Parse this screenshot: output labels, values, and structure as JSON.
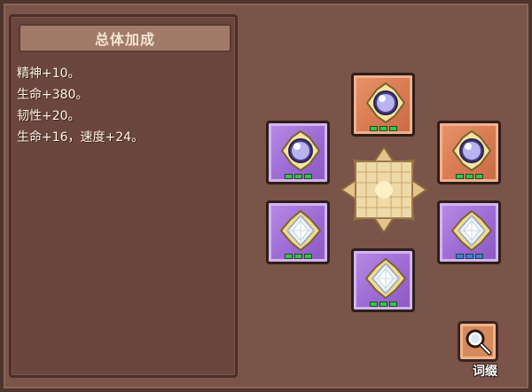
{
  "panel": {
    "title": "总体加成",
    "stats": [
      "精神+10。",
      "生命+380。",
      "韧性+20。",
      "生命+16，速度+24。"
    ]
  },
  "slots": [
    {
      "name": "gem-slot-top",
      "frame": "orange",
      "gem": "orb",
      "pips": [
        "green",
        "green",
        "green"
      ]
    },
    {
      "name": "gem-slot-upper-left",
      "frame": "purple",
      "gem": "orb",
      "pips": [
        "green",
        "green",
        "green"
      ]
    },
    {
      "name": "gem-slot-upper-right",
      "frame": "orange",
      "gem": "orb",
      "pips": [
        "green",
        "green",
        "green"
      ]
    },
    {
      "name": "gem-slot-lower-left",
      "frame": "purple",
      "gem": "diamond",
      "pips": [
        "green",
        "green",
        "green"
      ]
    },
    {
      "name": "gem-slot-lower-right",
      "frame": "purple",
      "gem": "diamond",
      "pips": [
        "blue",
        "blue",
        "blue"
      ]
    },
    {
      "name": "gem-slot-bottom",
      "frame": "purple",
      "gem": "diamond",
      "pips": [
        "green",
        "green",
        "green"
      ]
    }
  ],
  "affix_button": {
    "label": "词缀",
    "icon": "magnifier-icon"
  },
  "colors": {
    "pip_green": "#3fbf4a",
    "pip_blue": "#3c7ee0"
  }
}
